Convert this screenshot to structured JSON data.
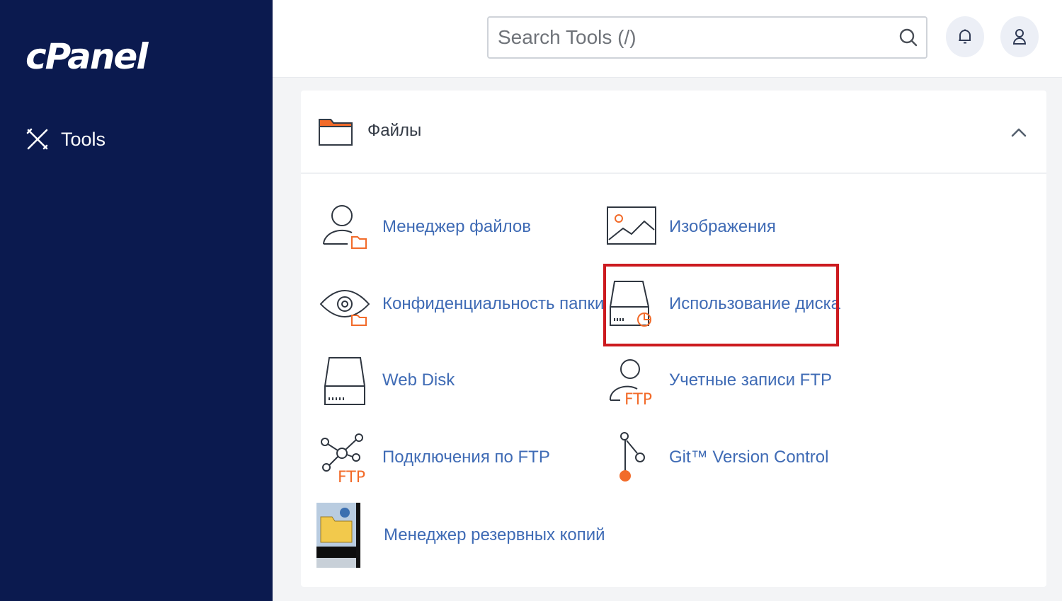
{
  "sidebar": {
    "logo": "cPanel",
    "nav_items": [
      {
        "label": "Tools",
        "icon": "tools-icon"
      }
    ]
  },
  "header": {
    "search": {
      "placeholder": "Search Tools (/)",
      "value": ""
    },
    "notifications_icon": "bell-icon",
    "user_icon": "user-icon"
  },
  "section": {
    "title": "Файлы",
    "icon": "folder-icon",
    "collapse_icon": "chevron-up-icon",
    "items": [
      {
        "label": "Менеджер файлов",
        "icon": "file-manager-icon"
      },
      {
        "label": "Изображения",
        "icon": "images-icon"
      },
      {
        "label": "Конфиденциальность папки",
        "icon": "directory-privacy-icon"
      },
      {
        "label": "Использование диска",
        "icon": "disk-usage-icon",
        "highlighted": true
      },
      {
        "label": "Web Disk",
        "icon": "web-disk-icon"
      },
      {
        "label": "Учетные записи FTP",
        "icon": "ftp-accounts-icon"
      },
      {
        "label": "Подключения по FTP",
        "icon": "ftp-connections-icon"
      },
      {
        "label": "Git™ Version Control",
        "icon": "git-icon"
      },
      {
        "label": "Менеджер резервных копий",
        "icon": "backup-manager-icon"
      }
    ]
  },
  "colors": {
    "sidebar_bg": "#0b1a4f",
    "link": "#3f6bb5",
    "accent_orange": "#f26b2a",
    "highlight_border": "#cc1a1f"
  }
}
